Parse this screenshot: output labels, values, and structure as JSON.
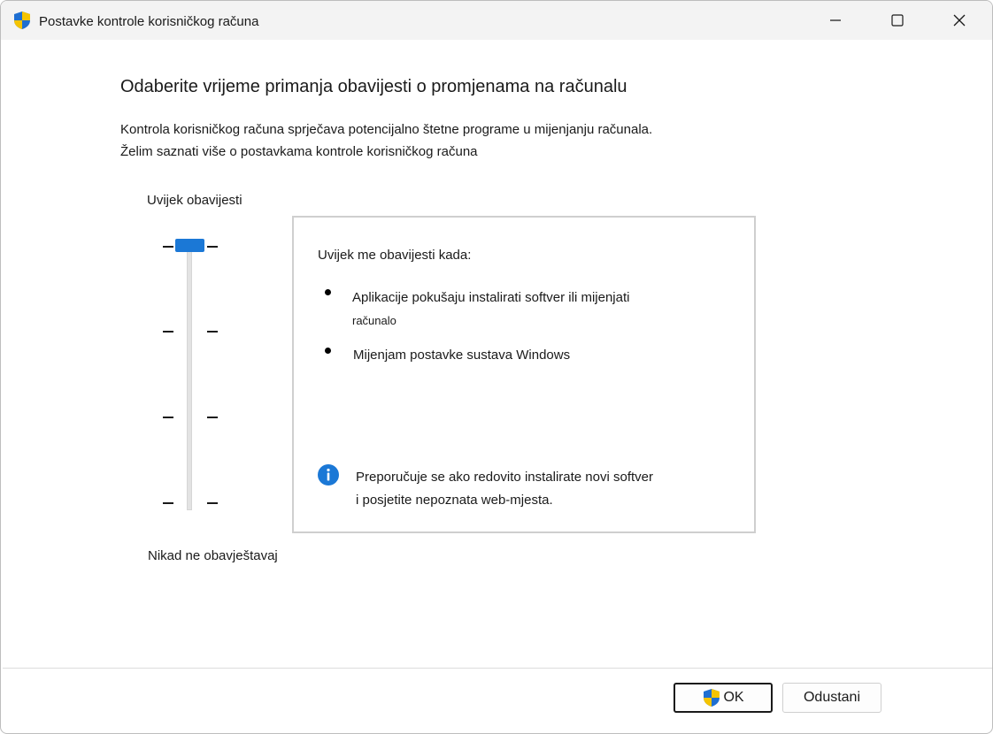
{
  "window": {
    "title": "Postavke kontrole korisničkog računa"
  },
  "content": {
    "heading": "Odaberite vrijeme primanja obavijesti o promjenama na računalu",
    "description": "Kontrola korisničkog računa sprječava potencijalno štetne programe u mijenjanju računala.",
    "learn_more": "Želim saznati više o postavkama kontrole korisničkog računa"
  },
  "slider": {
    "top_label": "Uvijek obavijesti",
    "bottom_label": "Nikad ne obavještavaj",
    "level_count": 4,
    "selected_level": 4
  },
  "info_box": {
    "title": "Uvijek me obavijesti kada:",
    "bullets": [
      {
        "line1": "Aplikacije pokušaju instalirati softver ili mijenjati",
        "line2": "računalo"
      },
      {
        "line1": "Mijenjam postavke sustava Windows"
      }
    ],
    "recommendation_line1": "Preporučuje se ako redovito instalirate novi softver",
    "recommendation_line2": "i posjetite nepoznata web-mjesta."
  },
  "buttons": {
    "ok": "OK",
    "cancel": "Odustani"
  },
  "colors": {
    "accent": "#1b78d6",
    "shield_blue": "#1f6fd1",
    "shield_yellow": "#f5c400"
  },
  "icons": {
    "app": "uac-shield-icon",
    "info": "info-icon",
    "ok_shield": "uac-shield-icon"
  }
}
